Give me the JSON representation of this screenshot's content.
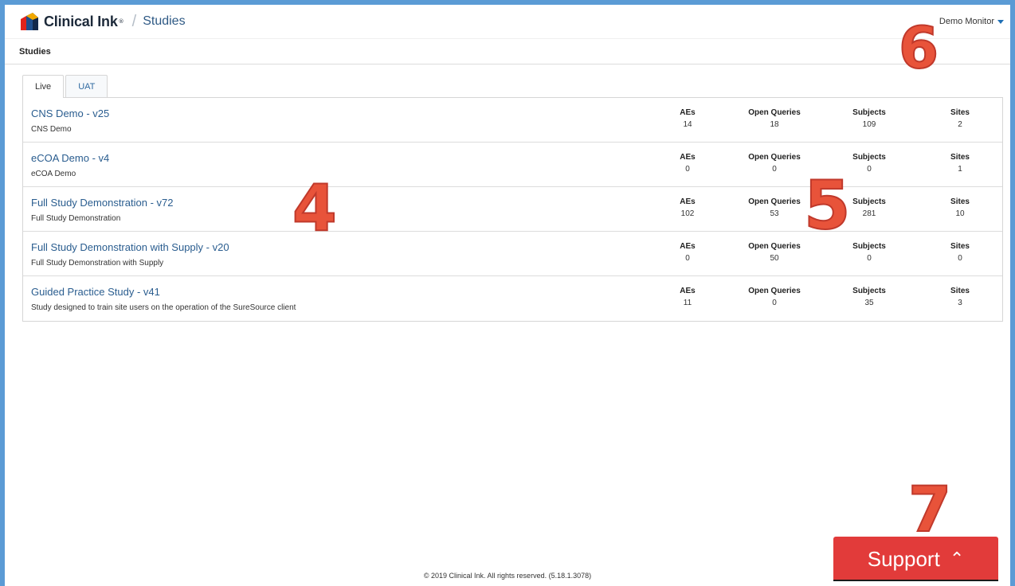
{
  "header": {
    "logo_text": "Clinical Ink",
    "logo_reg": "®",
    "separator": "/",
    "page": "Studies",
    "user": "Demo Monitor"
  },
  "subheader": {
    "title": "Studies"
  },
  "tabs": [
    {
      "label": "Live",
      "active": true
    },
    {
      "label": "UAT",
      "active": false
    }
  ],
  "stat_labels": {
    "aes": "AEs",
    "open_queries": "Open Queries",
    "subjects": "Subjects",
    "sites": "Sites"
  },
  "studies": [
    {
      "name": "CNS Demo - v25",
      "description": "CNS Demo",
      "aes": "14",
      "open_queries": "18",
      "subjects": "109",
      "sites": "2"
    },
    {
      "name": "eCOA Demo - v4",
      "description": "eCOA Demo",
      "aes": "0",
      "open_queries": "0",
      "subjects": "0",
      "sites": "1"
    },
    {
      "name": "Full Study Demonstration - v72",
      "description": "Full Study Demonstration",
      "aes": "102",
      "open_queries": "53",
      "subjects": "281",
      "sites": "10"
    },
    {
      "name": "Full Study Demonstration with Supply - v20",
      "description": "Full Study Demonstration with Supply",
      "aes": "0",
      "open_queries": "50",
      "subjects": "0",
      "sites": "0"
    },
    {
      "name": "Guided Practice Study - v41",
      "description": "Study designed to train site users on the operation of the SureSource client",
      "aes": "11",
      "open_queries": "0",
      "subjects": "35",
      "sites": "3"
    }
  ],
  "footer": {
    "text": "© 2019 Clinical Ink. All rights reserved. (5.18.1.3078)"
  },
  "support": {
    "label": "Support"
  },
  "annotations": {
    "a4": "4",
    "a5": "5",
    "a6": "6",
    "a7": "7"
  },
  "colors": {
    "frame": "#5b9bd5",
    "link": "#2a5d8f",
    "support": "#e23b3a",
    "annotation": "#e8533a"
  }
}
